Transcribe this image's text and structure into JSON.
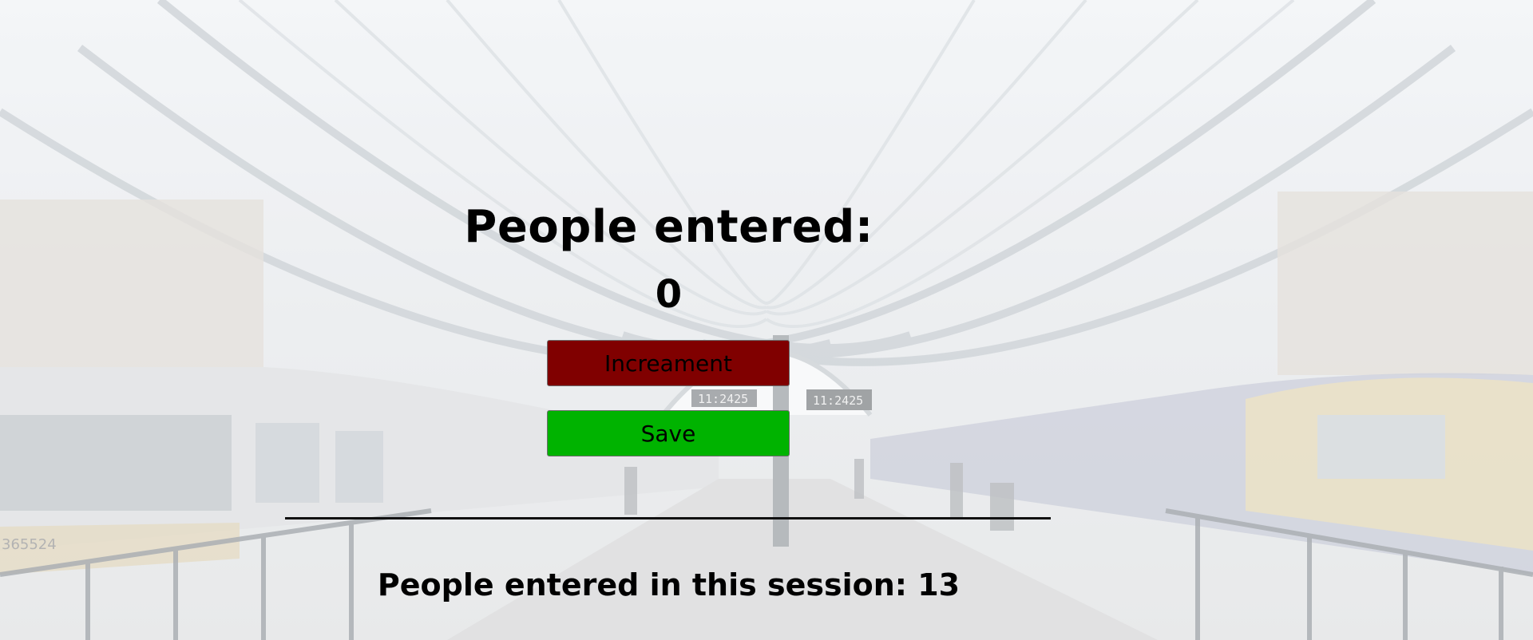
{
  "counter": {
    "heading": "People entered:",
    "value": "0"
  },
  "buttons": {
    "increment_label": "Increament",
    "save_label": "Save"
  },
  "session": {
    "label": "People entered in this session: 13"
  },
  "background": {
    "clock_text": "11:2425",
    "train_number": "365524"
  },
  "colors": {
    "increment_button": "#800000",
    "save_button": "#00b300",
    "text": "#000000"
  }
}
